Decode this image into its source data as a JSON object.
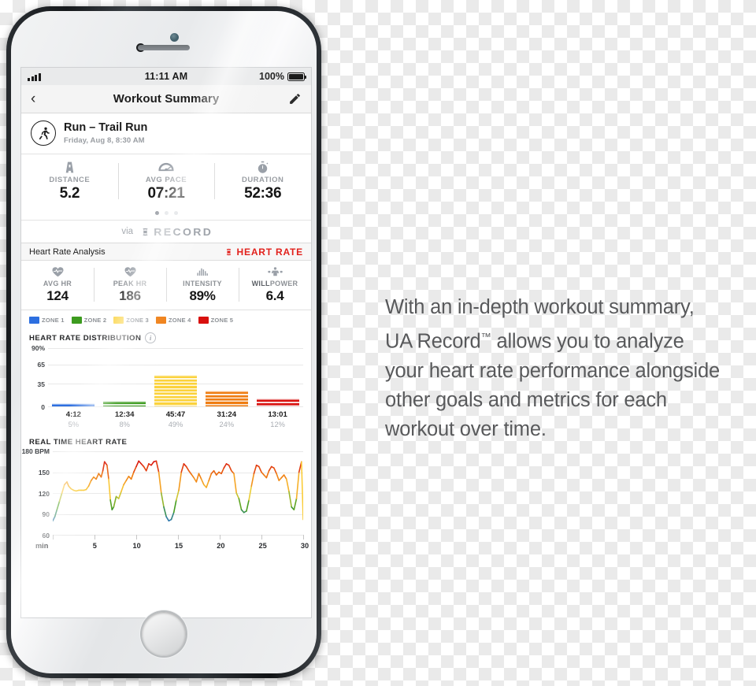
{
  "status_bar": {
    "time": "11:11 AM",
    "battery_percent": "100%",
    "signal_bars": 4
  },
  "nav": {
    "back_icon": "chevron-left-icon",
    "title": "Workout Summary",
    "edit_icon": "pencil-icon"
  },
  "workout": {
    "icon": "running-person-icon",
    "title": "Run – Trail Run",
    "subtitle": "Friday, Aug 8, 8:30 AM"
  },
  "stats": [
    {
      "icon": "road-icon",
      "label": "DISTANCE",
      "value": "5.2"
    },
    {
      "icon": "speedometer-icon",
      "label": "AVG PACE",
      "value": "07:21"
    },
    {
      "icon": "stopwatch-icon",
      "label": "DURATION",
      "value": "52:36"
    }
  ],
  "pager": {
    "count": 3,
    "active": 0
  },
  "via": {
    "prefix": "via",
    "logo_icon": "under-armour-logo-icon",
    "brand": "RECORD"
  },
  "hr_analysis": {
    "label": "Heart Rate Analysis",
    "badge_icon": "under-armour-logo-icon",
    "badge_text": "HEART RATE",
    "badge_color": "#e2211c"
  },
  "hr_metrics": [
    {
      "icon": "heart-pulse-icon",
      "label": "AVG HR",
      "value": "124"
    },
    {
      "icon": "heart-pulse-icon",
      "label": "PEAK HR",
      "value": "186"
    },
    {
      "icon": "bar-levels-icon",
      "label": "INTENSITY",
      "value": "89%"
    },
    {
      "icon": "athlete-icon",
      "label_strong": "WILL",
      "label_rest": "POWER",
      "value": "6.4"
    }
  ],
  "zones": [
    {
      "label": "ZONE 1",
      "color": "#2d6fe0"
    },
    {
      "label": "ZONE 2",
      "color": "#3d9b1f"
    },
    {
      "label": "ZONE 3",
      "color": "#fbd23b"
    },
    {
      "label": "ZONE 4",
      "color": "#ef7d12"
    },
    {
      "label": "ZONE 5",
      "color": "#d8100e"
    }
  ],
  "distribution": {
    "title": "HEART RATE DISTRIBUTION",
    "info_icon": "info-icon",
    "info_glyph": "i"
  },
  "realtime": {
    "title": "REAL TIME HEART RATE",
    "x_unit": "min"
  },
  "blurb": {
    "line1": "With an in-depth workout summary,",
    "line2a": "UA Record",
    "line2tm": "™",
    "line2b": " allows you to analyze",
    "line3": "your heart rate performance alongside",
    "line4": "other goals and metrics for each",
    "line5": "workout over time."
  },
  "chart_data": [
    {
      "type": "bar",
      "title": "HEART RATE DISTRIBUTION",
      "xlabel": "",
      "ylabel": "",
      "ylim": [
        0,
        90
      ],
      "yticks": [
        0,
        35,
        65,
        90
      ],
      "ytick_labels": [
        "0",
        "35",
        "65",
        "90%"
      ],
      "grid": true,
      "categories": [
        "Zone 1",
        "Zone 2",
        "Zone 3",
        "Zone 4",
        "Zone 5"
      ],
      "values": [
        5,
        8,
        49,
        24,
        12
      ],
      "colors": [
        "#2d6fe0",
        "#3d9b1f",
        "#fbd23b",
        "#ef7d12",
        "#d8100e"
      ],
      "bar_time_labels": [
        "4:12",
        "12:34",
        "45:47",
        "31:24",
        "13:01"
      ],
      "bar_percent_labels": [
        "5%",
        "8%",
        "49%",
        "24%",
        "12%"
      ],
      "legend": [
        "ZONE 1",
        "ZONE 2",
        "ZONE 3",
        "ZONE 4",
        "ZONE 5"
      ],
      "legend_position": "top"
    },
    {
      "type": "line",
      "title": "REAL TIME HEART RATE",
      "xlabel": "min",
      "ylabel": "BPM",
      "ylim": [
        60,
        180
      ],
      "yticks": [
        60,
        90,
        120,
        150,
        180
      ],
      "ytick_labels": [
        "60",
        "90",
        "120",
        "150",
        "180 BPM"
      ],
      "xlim": [
        0,
        30
      ],
      "xticks": [
        0,
        5,
        10,
        15,
        20,
        25,
        30
      ],
      "xtick_labels": [
        "",
        "5",
        "10",
        "15",
        "20",
        "25",
        "30"
      ],
      "grid": true,
      "series": [
        {
          "name": "Heart Rate",
          "color_mode": "zone-gradient",
          "x": [
            0.0,
            0.25,
            0.5,
            0.8,
            1.1,
            1.4,
            1.7,
            1.9,
            2.2,
            2.5,
            2.8,
            3.1,
            3.4,
            3.7,
            4.0,
            4.3,
            4.6,
            4.9,
            5.2,
            5.5,
            5.8,
            6.0,
            6.2,
            6.5,
            6.7,
            6.9,
            7.1,
            7.3,
            7.6,
            7.9,
            8.2,
            8.5,
            8.8,
            9.1,
            9.4,
            9.7,
            10.0,
            10.3,
            10.6,
            10.9,
            11.2,
            11.5,
            11.8,
            12.1,
            12.4,
            12.7,
            13.0,
            13.3,
            13.6,
            13.9,
            14.2,
            14.5,
            14.8,
            15.1,
            15.4,
            15.7,
            16.0,
            16.3,
            16.6,
            16.9,
            17.2,
            17.5,
            17.8,
            18.1,
            18.4,
            18.7,
            19.0,
            19.3,
            19.6,
            19.9,
            20.2,
            20.5,
            20.8,
            21.1,
            21.4,
            21.7,
            22.0,
            22.3,
            22.6,
            22.9,
            23.2,
            23.5,
            23.8,
            24.1,
            24.4,
            24.7,
            25.0,
            25.3,
            25.6,
            25.9,
            26.2,
            26.5,
            26.8,
            27.1,
            27.4,
            27.7,
            28.0,
            28.3,
            28.6,
            28.9,
            29.2,
            29.5,
            29.8,
            30.0
          ],
          "y": [
            80,
            86,
            96,
            108,
            120,
            132,
            136,
            130,
            126,
            124,
            123,
            124,
            124,
            124,
            125,
            130,
            138,
            143,
            140,
            148,
            143,
            152,
            165,
            160,
            140,
            110,
            96,
            100,
            115,
            112,
            122,
            132,
            138,
            144,
            140,
            150,
            158,
            166,
            162,
            158,
            152,
            162,
            160,
            165,
            166,
            150,
            120,
            100,
            86,
            80,
            82,
            92,
            110,
            124,
            150,
            162,
            158,
            152,
            147,
            142,
            136,
            148,
            140,
            132,
            128,
            138,
            148,
            152,
            146,
            150,
            148,
            156,
            162,
            160,
            152,
            148,
            120,
            112,
            96,
            92,
            94,
            110,
            130,
            148,
            160,
            158,
            150,
            146,
            142,
            152,
            158,
            156,
            148,
            138,
            142,
            146,
            140,
            122,
            100,
            96,
            112,
            150,
            165,
            82
          ]
        }
      ]
    }
  ]
}
